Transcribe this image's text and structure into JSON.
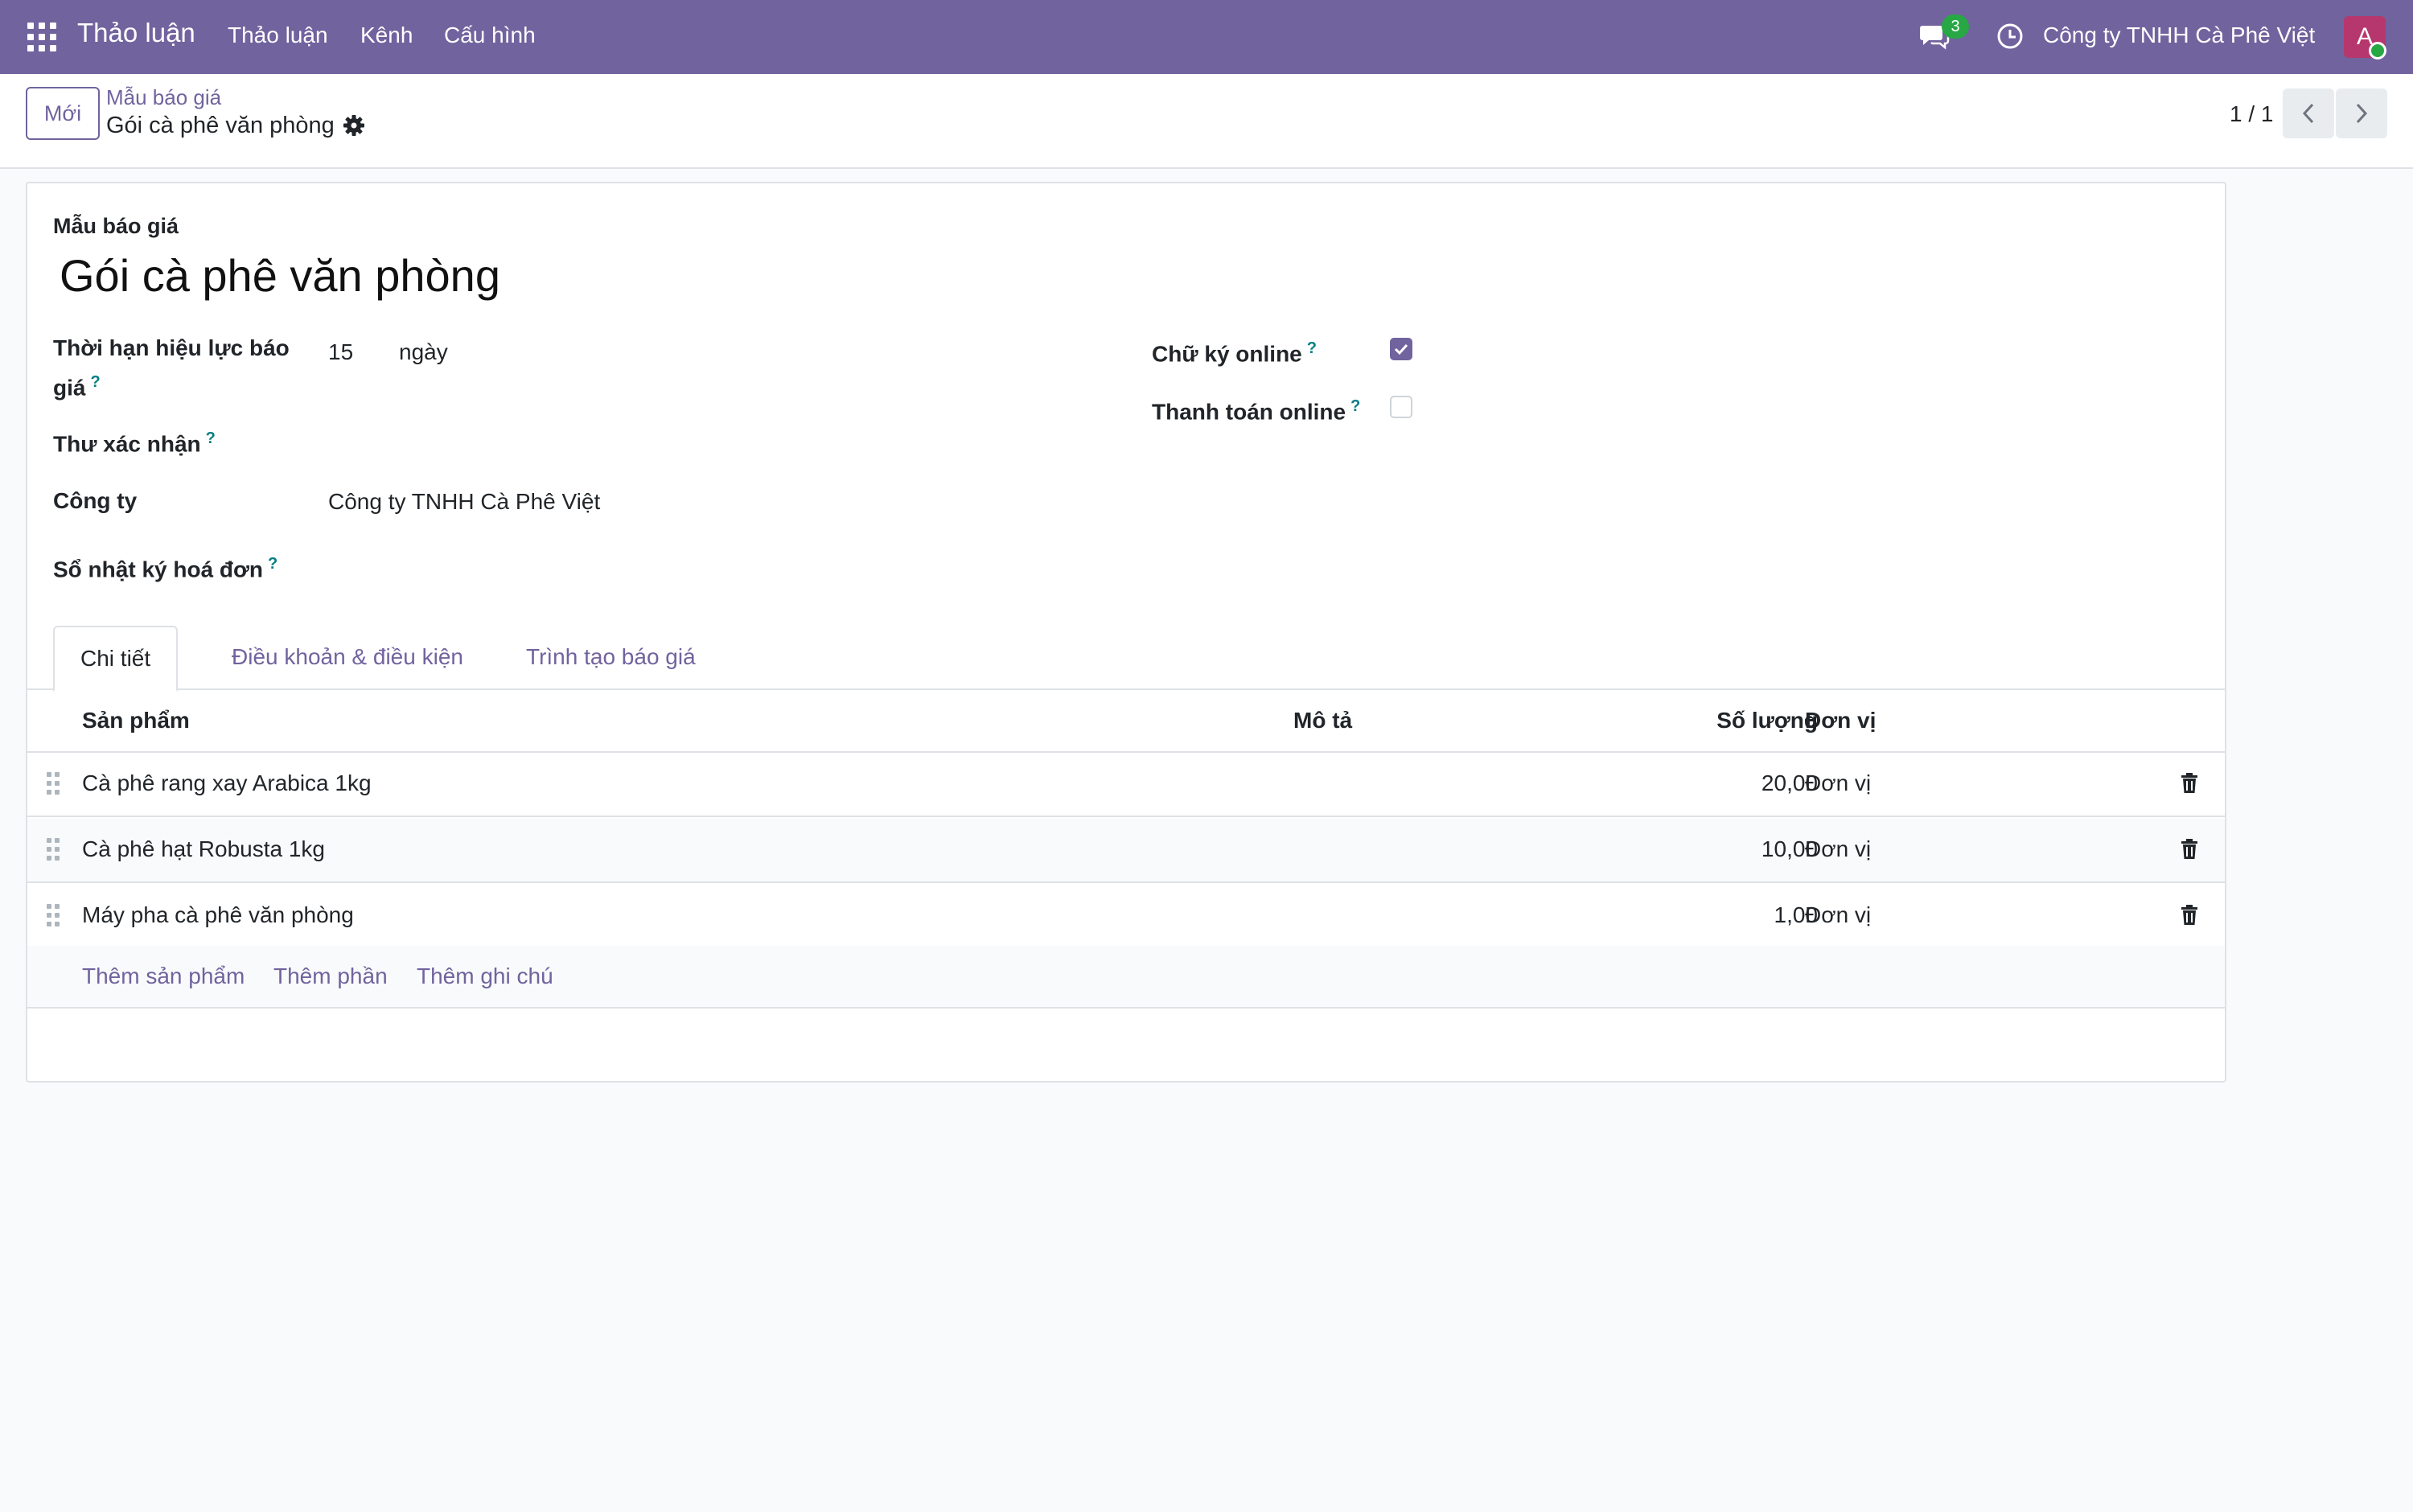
{
  "topbar": {
    "app_title": "Thảo luận",
    "menus": [
      "Thảo luận",
      "Kênh",
      "Cấu hình"
    ],
    "messages_count": "3",
    "company": "Công ty TNHH Cà Phê Việt",
    "avatar_letter": "A",
    "colors": {
      "bar": "#71639e",
      "badge": "#28a745",
      "avatar": "#b5376d"
    }
  },
  "control": {
    "new_button": "Mới",
    "breadcrumb_parent": "Mẫu báo giá",
    "breadcrumb_current": "Gói cà phê văn phòng",
    "pager": "1 / 1"
  },
  "form": {
    "model_label": "Mẫu báo giá",
    "name": "Gói cà phê văn phòng",
    "validity_label_line1": "Thời hạn hiệu lực báo",
    "validity_label_line2": "giá",
    "validity_value": "15",
    "validity_unit": "ngày",
    "confirmation_mail_label": "Thư xác nhận",
    "company_label": "Công ty",
    "company_value": "Công ty TNHH Cà Phê Việt",
    "journal_label": "Sổ nhật ký hoá đơn",
    "online_signature_label": "Chữ ký online",
    "online_signature_checked": true,
    "online_payment_label": "Thanh toán online",
    "online_payment_checked": false,
    "help_mark": "?"
  },
  "tabs": [
    "Chi tiết",
    "Điều khoản & điều kiện",
    "Trình tạo báo giá"
  ],
  "table": {
    "headers": {
      "product": "Sản phẩm",
      "description": "Mô tả",
      "quantity": "Số lượng",
      "uom": "Đơn vị"
    },
    "rows": [
      {
        "product": "Cà phê rang xay Arabica 1kg",
        "description": "",
        "quantity": "20,00",
        "uom": "Đơn vị"
      },
      {
        "product": "Cà phê hạt Robusta 1kg",
        "description": "",
        "quantity": "10,00",
        "uom": "Đơn vị"
      },
      {
        "product": "Máy pha cà phê văn phòng",
        "description": "",
        "quantity": "1,00",
        "uom": "Đơn vị"
      }
    ],
    "add_links": [
      "Thêm sản phẩm",
      "Thêm phần",
      "Thêm ghi chú"
    ]
  }
}
